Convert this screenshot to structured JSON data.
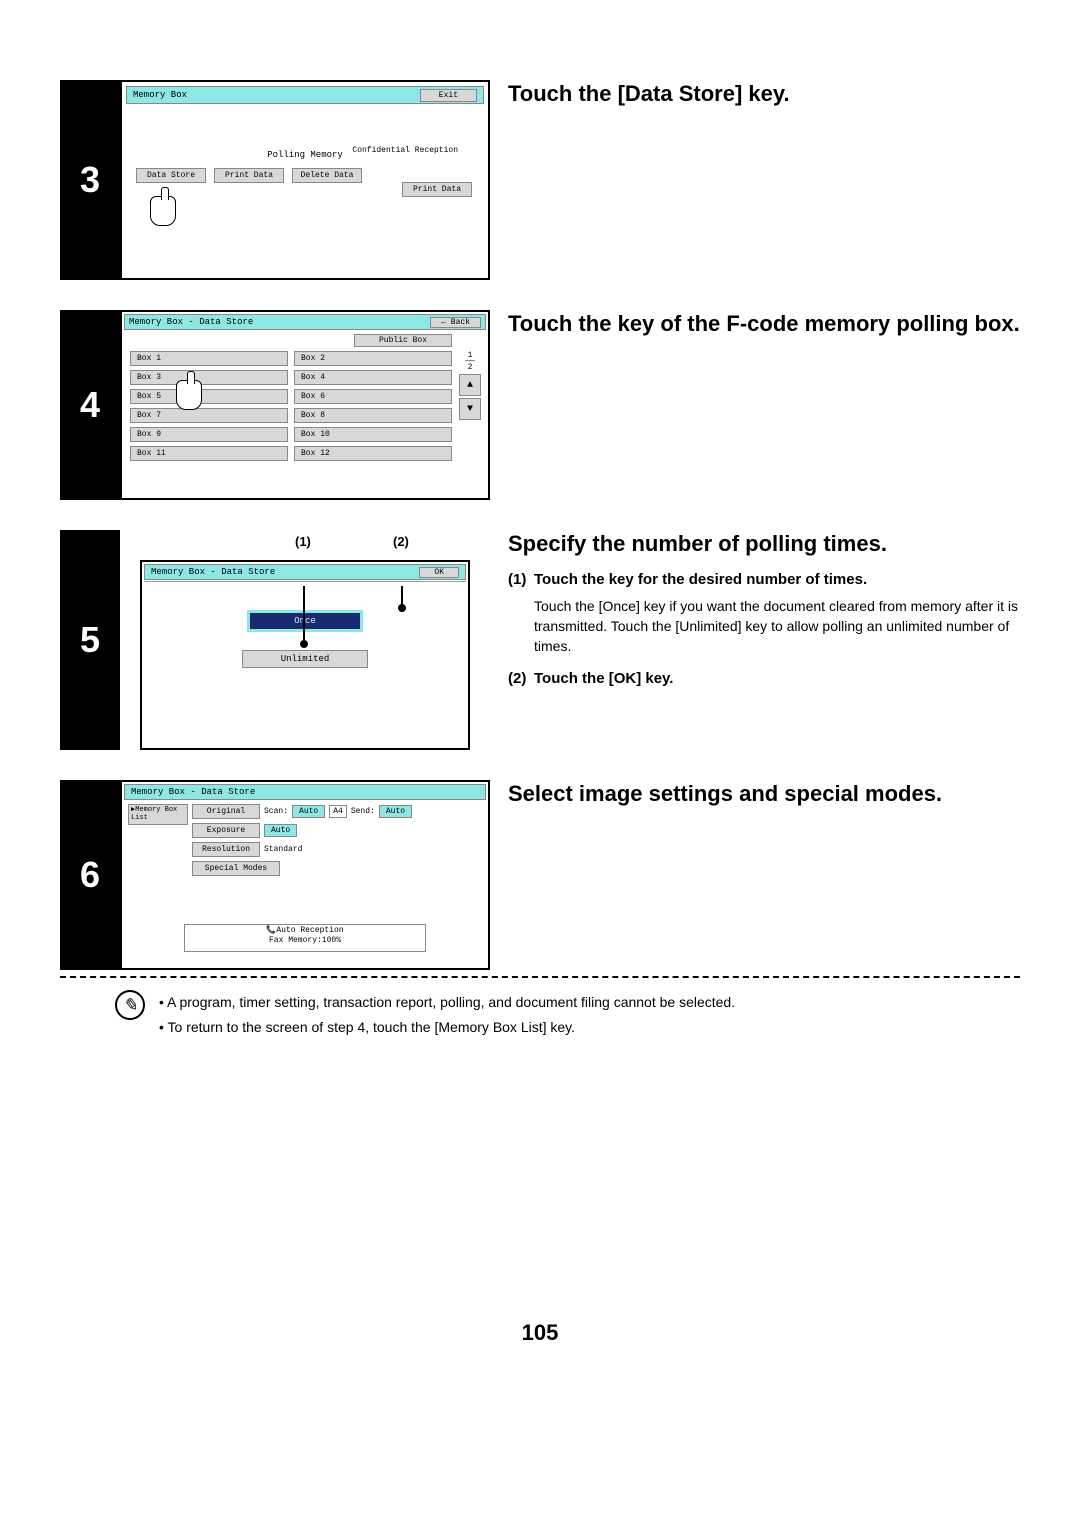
{
  "page_number": "105",
  "steps": {
    "s3": {
      "num": "3",
      "heading": "Touch the [Data Store] key.",
      "screen": {
        "title": "Memory Box",
        "exit": "Exit",
        "polling_memory": "Polling Memory",
        "confidential": "Confidential\nReception",
        "btn_data_store": "Data Store",
        "btn_print_data": "Print Data",
        "btn_delete_data": "Delete Data",
        "btn_print_data2": "Print Data"
      }
    },
    "s4": {
      "num": "4",
      "heading": "Touch the key of the F-code memory polling box.",
      "screen": {
        "title": "Memory Box - Data Store",
        "back": "Back",
        "public_box": "Public Box",
        "boxes": [
          "Box 1",
          "Box 2",
          "Box 3",
          "Box 4",
          "Box 5",
          "Box 6",
          "Box 7",
          "Box 8",
          "Box 9",
          "Box 10",
          "Box 11",
          "Box 12"
        ],
        "pg_cur": "1",
        "pg_tot": "2",
        "up": "▲",
        "down": "▼"
      }
    },
    "s5": {
      "num": "5",
      "heading": "Specify the number of polling times.",
      "callout1": "(1)",
      "callout2": "(2)",
      "screen": {
        "title": "Memory Box - Data Store",
        "ok": "OK",
        "once": "Once",
        "unlimited": "Unlimited"
      },
      "sub1_num": "(1)",
      "sub1_lead": "Touch the key for the desired number of times.",
      "sub1_body": "Touch the [Once] key if you want the document cleared from memory after it is transmitted. Touch the [Unlimited] key to allow polling an unlimited number of times.",
      "sub2_num": "(2)",
      "sub2_lead": "Touch the [OK] key."
    },
    "s6": {
      "num": "6",
      "heading": "Select image settings and special modes.",
      "screen": {
        "title": "Memory Box - Data Store",
        "memory_box_list": "Memory Box List",
        "original": "Original",
        "exposure": "Exposure",
        "resolution": "Resolution",
        "special_modes": "Special Modes",
        "scan": "Scan:",
        "auto": "Auto",
        "a4": "A4",
        "send": "Send:",
        "auto2": "Auto",
        "auto3": "Auto",
        "standard": "Standard",
        "auto_reception": "Auto Reception",
        "fax_memory": "Fax Memory:100%"
      }
    }
  },
  "notes": {
    "line1": "• A program, timer setting, transaction report, polling, and document filing cannot be selected.",
    "line2": "• To return to the screen of step 4, touch the [Memory Box List] key."
  }
}
